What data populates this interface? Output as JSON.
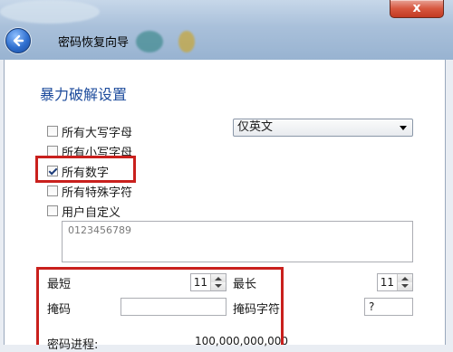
{
  "window": {
    "close_label": "x",
    "wizard_title": "密码恢复向导"
  },
  "section": {
    "heading": "暴力破解设置"
  },
  "charset_options": [
    {
      "label": "所有大写字母",
      "checked": false
    },
    {
      "label": "所有小写字母",
      "checked": false
    },
    {
      "label": "所有数字",
      "checked": true
    },
    {
      "label": "所有特殊字符",
      "checked": false
    },
    {
      "label": "用户自定义",
      "checked": false
    }
  ],
  "language_select": {
    "value": "仅英文"
  },
  "custom_chars": {
    "placeholder": "0123456789"
  },
  "length": {
    "min_label": "最短",
    "min_value": "11",
    "max_label": "最长",
    "max_value": "11"
  },
  "mask": {
    "label": "掩码",
    "value": "",
    "char_label": "掩码字符",
    "char_value": "?"
  },
  "progress": {
    "label": "密码进程:",
    "value": "100,000,000,000"
  },
  "colors": {
    "highlight": "#c9201d",
    "heading": "#1e4c9c"
  }
}
